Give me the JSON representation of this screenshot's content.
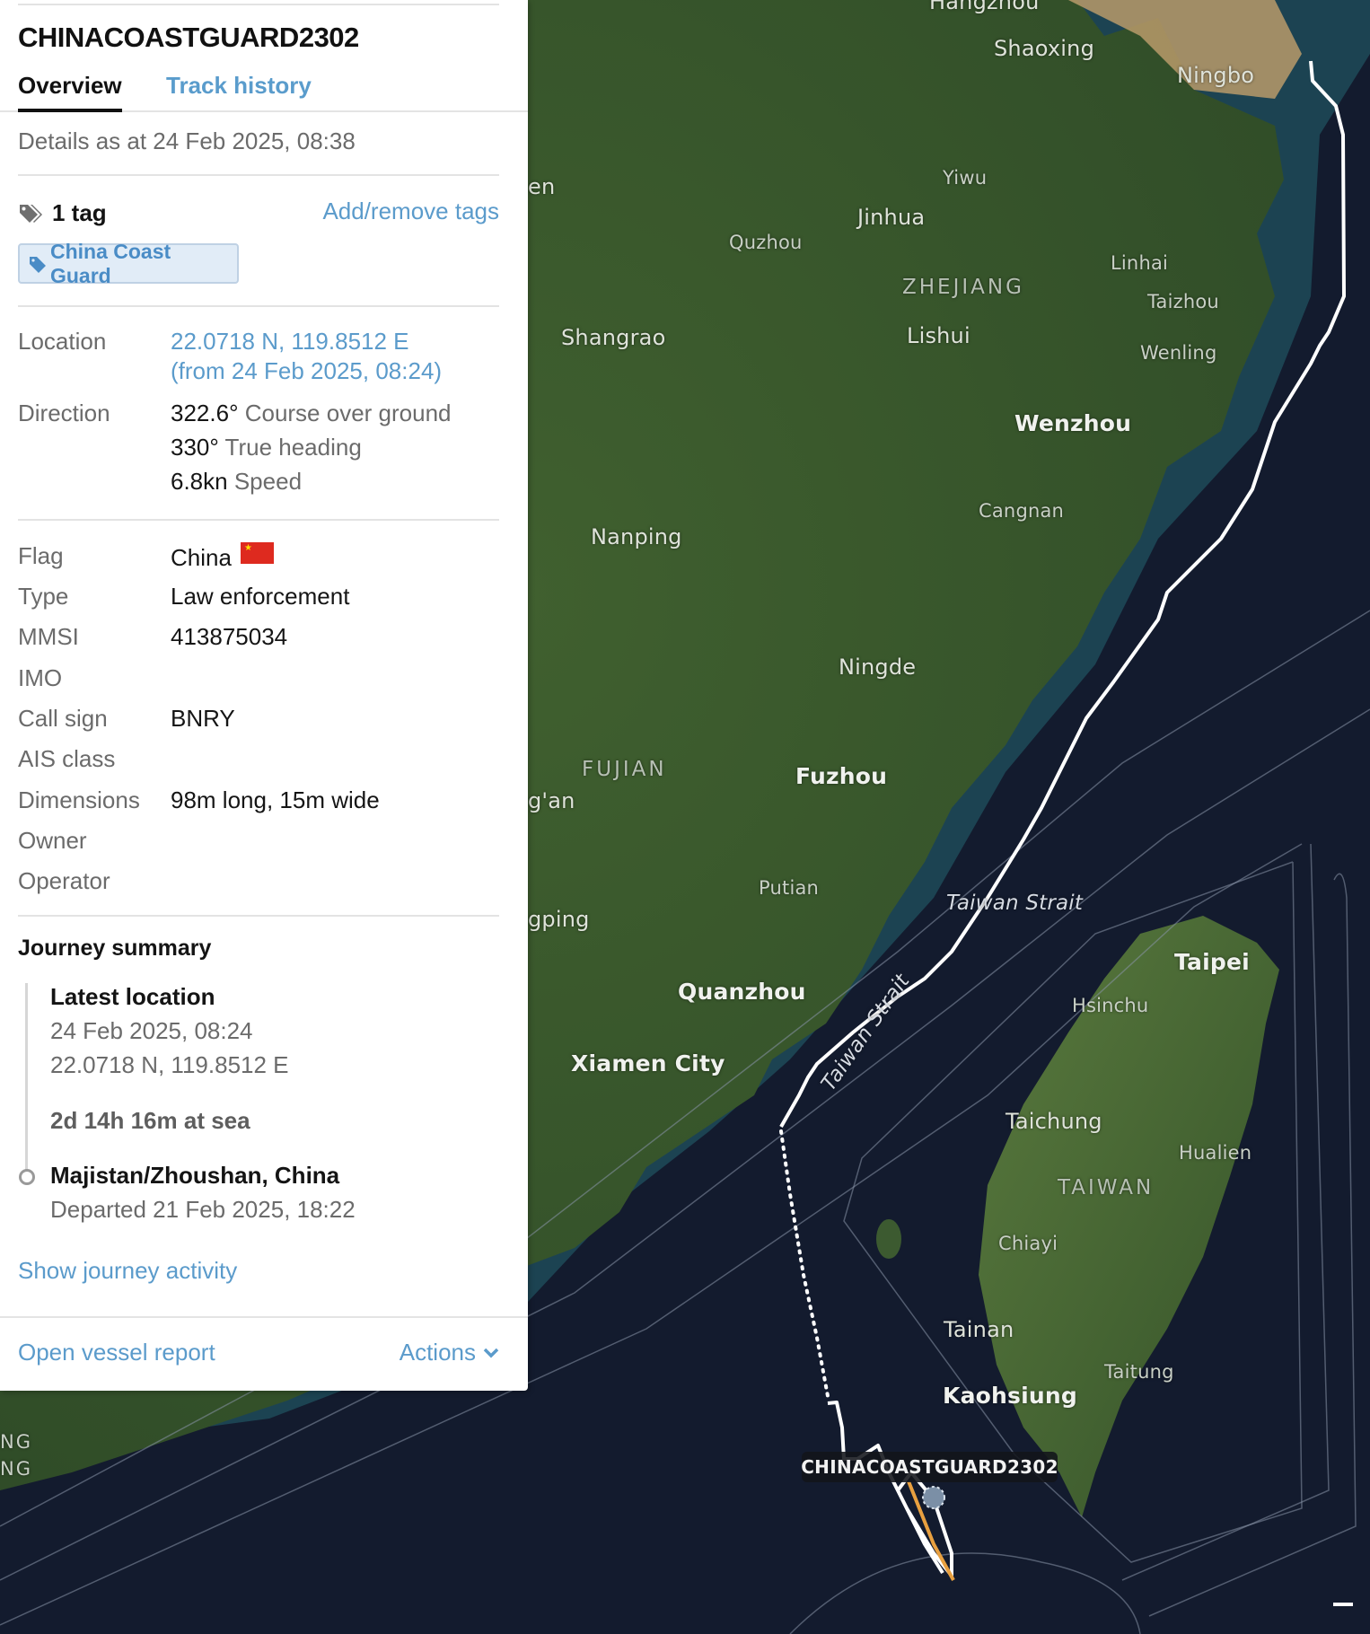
{
  "vessel": {
    "name": "CHINACOASTGUARD2302"
  },
  "tabs": [
    {
      "label": "Overview",
      "active": true
    },
    {
      "label": "Track history",
      "active": false
    }
  ],
  "details_as_at": "Details as at 24 Feb 2025, 08:38",
  "tags": {
    "count_label": "1 tag",
    "edit_link": "Add/remove tags",
    "items": [
      "China Coast Guard"
    ],
    "icon": "tags-icon"
  },
  "position": {
    "location_label": "Location",
    "location_value": "22.0718 N, 119.8512 E",
    "location_time": "(from 24 Feb 2025, 08:24)",
    "direction_label": "Direction",
    "course": {
      "value": "322.6°",
      "label": "Course over ground"
    },
    "heading": {
      "value": "330°",
      "label": "True heading"
    },
    "speed": {
      "value": "6.8kn",
      "label": "Speed"
    }
  },
  "particulars": [
    {
      "label": "Flag",
      "value": "China",
      "flag": "china-flag"
    },
    {
      "label": "Type",
      "value": "Law enforcement"
    },
    {
      "label": "MMSI",
      "value": "413875034"
    },
    {
      "label": "IMO",
      "value": ""
    },
    {
      "label": "Call sign",
      "value": "BNRY"
    },
    {
      "label": "AIS class",
      "value": ""
    },
    {
      "label": "Dimensions",
      "value": "98m long, 15m wide"
    },
    {
      "label": "Owner",
      "value": ""
    },
    {
      "label": "Operator",
      "value": ""
    }
  ],
  "journey": {
    "title": "Journey summary",
    "latest": {
      "heading": "Latest location",
      "time": "24 Feb 2025, 08:24",
      "coords": "22.0718 N, 119.8512 E"
    },
    "duration": "2d 14h 16m at sea",
    "origin": {
      "port": "Majistan/Zhoushan, China",
      "departed": "Departed 21 Feb 2025, 18:22"
    },
    "show_activity": "Show journey activity"
  },
  "footer": {
    "report_link": "Open vessel report",
    "actions_label": "Actions"
  },
  "map": {
    "vessel_label": "CHINACOASTGUARD2302",
    "labels": {
      "hangzhou": "Hangzhou",
      "shaoxing": "Shaoxing",
      "ningbo": "Ningbo",
      "yiwu": "Yiwu",
      "jinhua": "Jinhua",
      "quzhou": "Quzhou",
      "zhejiang": "ZHEJIANG",
      "linhai": "Linhai",
      "taizhou": "Taizhou",
      "shangrao": "Shangrao",
      "lishui": "Lishui",
      "wenling": "Wenling",
      "wenzhou": "Wenzhou",
      "cangnan": "Cangnan",
      "nanping": "Nanping",
      "ningde": "Ningde",
      "fujian": "FUJIAN",
      "fuzhou": "Fuzhou",
      "putian": "Putian",
      "taiwan_strait_1": "Taiwan Strait",
      "taiwan_strait_2": "Taiwan Strait",
      "taipei": "Taipei",
      "hsinchu": "Hsinchu",
      "quanzhou": "Quanzhou",
      "xiamen": "Xiamen City",
      "taichung": "Taichung",
      "hualien": "Hualien",
      "taiwan": "TAIWAN",
      "chiayi": "Chiayi",
      "tainan": "Tainan",
      "taitung": "Taitung",
      "kaohsiung": "Kaohsiung",
      "partial_en": "en",
      "partial_an": "g'an",
      "partial_gping": "gping",
      "partial_ng1": "NG",
      "partial_ng2": "NG"
    }
  },
  "colors": {
    "link": "#5b9bcb",
    "track": "#ffffff",
    "track_recent": "#e8a040",
    "sea": "#131b2e",
    "flag_red": "#de2a1f"
  }
}
